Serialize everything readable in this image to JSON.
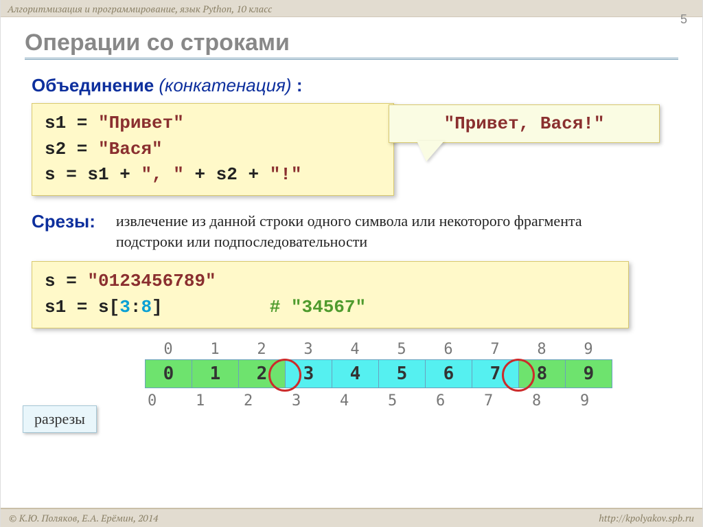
{
  "header": "Алгоритмизация и программирование, язык Python, 10 класс",
  "pageNumber": "5",
  "title": "Операции со строками",
  "concat": {
    "label": "Объединение",
    "paren": "(конкатенация)",
    "colon": " :",
    "code": {
      "l1a": "s1 = ",
      "l1b": "\"Привет\"",
      "l2a": "s2 = ",
      "l2b": "\"Вася\"",
      "l3a": "s  = s1 + ",
      "l3b": "\", \"",
      "l3c": " + s2 + ",
      "l3d": "\"!\""
    },
    "callout": "\"Привет, Вася!\""
  },
  "slice": {
    "label": "Срезы:",
    "desc": "извлечение из данной строки одного символа или некоторого фрагмента подстроки или подпоследовательности",
    "code": {
      "l1a": "s = ",
      "l1b": "\"0123456789\"",
      "l2a": "s1 = s[",
      "l2b": "3",
      "l2c": ":",
      "l2d": "8",
      "l2e": "]",
      "commentPad": "          ",
      "comment": "# \"34567\""
    },
    "topIdx": [
      "0",
      "1",
      "2",
      "3",
      "4",
      "5",
      "6",
      "7",
      "8",
      "9"
    ],
    "cells": [
      "0",
      "1",
      "2",
      "3",
      "4",
      "5",
      "6",
      "7",
      "8",
      "9"
    ],
    "botIdx": [
      "0",
      "1",
      "2",
      "3",
      "4",
      "5",
      "6",
      "7",
      "8",
      "9"
    ],
    "cutLabel": "разрезы"
  },
  "footer": {
    "left": "© К.Ю. Поляков, Е.А. Ерёмин, 2014",
    "right": "http://kpolyakov.spb.ru"
  }
}
